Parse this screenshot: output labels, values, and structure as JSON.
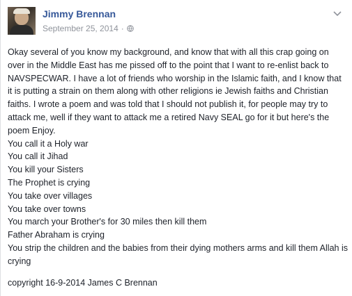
{
  "post": {
    "author": "Jimmy Brennan",
    "date": "September 25, 2014",
    "separator": "·",
    "privacy_icon": "globe-icon",
    "menu_icon": "chevron-down-icon",
    "intro": "Okay several of you know my background, and know that with all this crap going on over in the Middle East has me pissed off to the point that I want to re-enlist back to NAVSPECWAR. I have a lot of friends who worship in the Islamic faith, and I know that it is putting a strain on them along with other religions ie Jewish faiths and Christian faiths. I wrote a poem and was told that I should not publish it, for people may try to attack me, well if they want to attack me a retired Navy SEAL go for it but here's the poem Enjoy.",
    "poem": [
      "You call it a Holy war",
      "You call it Jihad",
      "You kill your Sisters",
      "The Prophet is crying",
      "You take over villages",
      "You take over towns",
      "You march your Brother's for 30 miles then kill them",
      "Father Abraham is crying",
      "You strip the children and the babies from their dying mothers arms and kill them Allah is crying"
    ],
    "copyright": "copyright 16-9-2014 James C Brennan"
  },
  "colors": {
    "name_link": "#365899",
    "meta_text": "#90949c",
    "body_text": "#1d2129"
  }
}
